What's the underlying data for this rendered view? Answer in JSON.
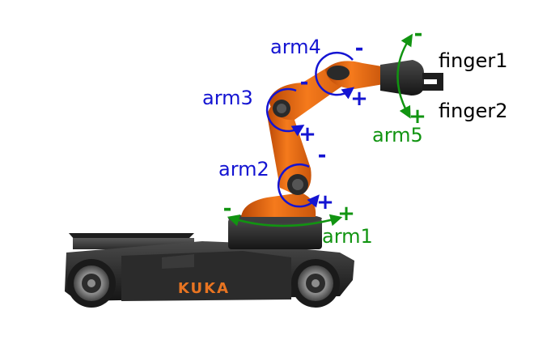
{
  "colors": {
    "joint_blue": "#1414d2",
    "joint_green": "#119411",
    "text_black": "#000000",
    "robot_orange": "#ee6a10",
    "robot_dark": "#232323",
    "logo_orange": "#e87421"
  },
  "brand": {
    "logo": "KUKA"
  },
  "joints": [
    {
      "name": "arm1",
      "plus": "+",
      "minus": "-",
      "color": "#119411"
    },
    {
      "name": "arm2",
      "plus": "+",
      "minus": "-",
      "color": "#1414d2"
    },
    {
      "name": "arm3",
      "plus": "+",
      "minus": "-",
      "color": "#1414d2"
    },
    {
      "name": "arm4",
      "plus": "+",
      "minus": "-",
      "color": "#1414d2"
    },
    {
      "name": "arm5",
      "plus": "+",
      "minus": "-",
      "color": "#119411"
    }
  ],
  "gripper": {
    "finger1": "finger1",
    "finger2": "finger2"
  }
}
